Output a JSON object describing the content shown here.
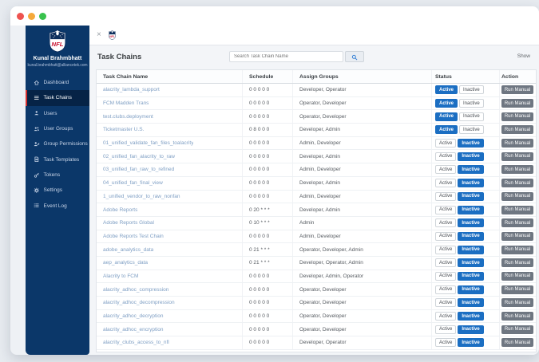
{
  "window": {
    "traffic_lights": [
      "close",
      "minimize",
      "maximize"
    ]
  },
  "topbar": {
    "close_glyph": "×"
  },
  "sidebar": {
    "user": {
      "name": "Kunal Brahmbhatt",
      "email": "kunal.brahmbhatt@alliancetek.com"
    },
    "items": [
      {
        "label": "Dashboard",
        "icon": "home-icon",
        "active": false
      },
      {
        "label": "Task Chains",
        "icon": "list-icon",
        "active": true
      },
      {
        "label": "Users",
        "icon": "user-icon",
        "active": false
      },
      {
        "label": "User Groups",
        "icon": "users-icon",
        "active": false
      },
      {
        "label": "Group Permissions",
        "icon": "user-permissions-icon",
        "active": false
      },
      {
        "label": "Task Templates",
        "icon": "file-icon",
        "active": false
      },
      {
        "label": "Tokens",
        "icon": "key-icon",
        "active": false
      },
      {
        "label": "Settings",
        "icon": "gear-icon",
        "active": false
      },
      {
        "label": "Event Log",
        "icon": "log-icon",
        "active": false
      }
    ]
  },
  "main": {
    "title": "Task Chains",
    "search": {
      "placeholder": "Search Task Chain Name",
      "icon": "search-icon"
    },
    "show_label": "Show",
    "table": {
      "columns": [
        "Task Chain Name",
        "Schedule",
        "Assign Groups",
        "Status",
        "Action"
      ],
      "status_labels": {
        "active": "Active",
        "inactive": "Inactive"
      },
      "run_label": "Run Manual",
      "rows": [
        {
          "name": "alacrity_lambda_support",
          "schedule": "0 0 0 0 0",
          "groups": "Developer, Operator",
          "status": "active"
        },
        {
          "name": "FCM Madden Trans",
          "schedule": "0 0 0 0 0",
          "groups": "Operator, Developer",
          "status": "active"
        },
        {
          "name": "test.clubs.deployment",
          "schedule": "0 0 0 0 0",
          "groups": "Operator, Developer",
          "status": "active"
        },
        {
          "name": "Ticketmaster U.S.",
          "schedule": "0 8 0 0 0",
          "groups": "Developer, Admin",
          "status": "active"
        },
        {
          "name": "01_unified_validate_fan_files_toalacrity",
          "schedule": "0 0 0 0 0",
          "groups": "Admin, Developer",
          "status": "inactive"
        },
        {
          "name": "02_unified_fan_alacrity_to_raw",
          "schedule": "0 0 0 0 0",
          "groups": "Developer, Admin",
          "status": "inactive"
        },
        {
          "name": "03_unified_fan_raw_to_refined",
          "schedule": "0 0 0 0 0",
          "groups": "Admin, Developer",
          "status": "inactive"
        },
        {
          "name": "04_unified_fan_final_view",
          "schedule": "0 0 0 0 0",
          "groups": "Developer, Admin",
          "status": "inactive"
        },
        {
          "name": "1_unified_vendor_to_raw_nonfan",
          "schedule": "0 0 0 0 0",
          "groups": "Admin, Developer",
          "status": "inactive"
        },
        {
          "name": "Adobe Reports",
          "schedule": "0 20 * * *",
          "groups": "Developer, Admin",
          "status": "inactive"
        },
        {
          "name": "Adobe Reports Global",
          "schedule": "0 10 * * *",
          "groups": "Admin",
          "status": "inactive"
        },
        {
          "name": "Adobe Reports Test Chain",
          "schedule": "0 0 0 0 0",
          "groups": "Admin, Developer",
          "status": "inactive"
        },
        {
          "name": "adobe_analytics_data",
          "schedule": "0 21 * * *",
          "groups": "Operator, Developer, Admin",
          "status": "inactive"
        },
        {
          "name": "aep_analytics_data",
          "schedule": "0 21 * * *",
          "groups": "Developer, Operator, Admin",
          "status": "inactive"
        },
        {
          "name": "Alacrity to FCM",
          "schedule": "0 0 0 0 0",
          "groups": "Developer, Admin, Operator",
          "status": "inactive"
        },
        {
          "name": "alacrity_adhoc_compression",
          "schedule": "0 0 0 0 0",
          "groups": "Operator, Developer",
          "status": "inactive"
        },
        {
          "name": "alacrity_adhoc_decompression",
          "schedule": "0 0 0 0 0",
          "groups": "Operator, Developer",
          "status": "inactive"
        },
        {
          "name": "alacrity_adhoc_decryption",
          "schedule": "0 0 0 0 0",
          "groups": "Operator, Developer",
          "status": "inactive"
        },
        {
          "name": "alacrity_adhoc_encryption",
          "schedule": "0 0 0 0 0",
          "groups": "Operator, Developer",
          "status": "inactive"
        },
        {
          "name": "alacrity_clubs_access_to_nfl",
          "schedule": "0 0 0 0 0",
          "groups": "Developer, Operator",
          "status": "inactive"
        }
      ]
    }
  },
  "colors": {
    "sidebar": "#0b3769",
    "active_blue": "#1b6ec2",
    "accent_red": "#d32f2f",
    "link": "#7f9fc4",
    "run_button": "#6e7681"
  }
}
